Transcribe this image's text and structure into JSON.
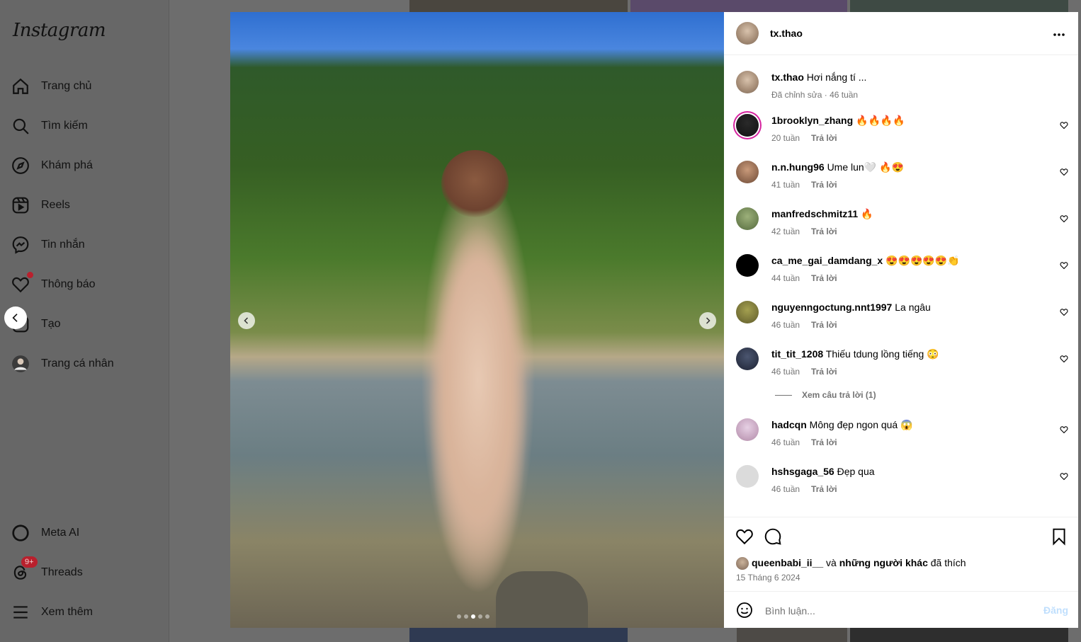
{
  "sidebar": {
    "logo": "Instagram",
    "items": [
      {
        "label": "Trang chủ",
        "icon": "home-icon"
      },
      {
        "label": "Tìm kiếm",
        "icon": "search-icon"
      },
      {
        "label": "Khám phá",
        "icon": "compass-icon"
      },
      {
        "label": "Reels",
        "icon": "reels-icon"
      },
      {
        "label": "Tin nhắn",
        "icon": "messenger-icon"
      },
      {
        "label": "Thông báo",
        "icon": "heart-icon"
      },
      {
        "label": "Tạo",
        "icon": "create-icon"
      },
      {
        "label": "Trang cá nhân",
        "icon": "profile-avatar-icon"
      }
    ],
    "bottom_items": [
      {
        "label": "Meta AI",
        "icon": "meta-ai-icon"
      },
      {
        "label": "Threads",
        "icon": "threads-icon",
        "badge": "9+"
      },
      {
        "label": "Xem thêm",
        "icon": "menu-icon"
      }
    ]
  },
  "post": {
    "author": "tx.thao",
    "caption": "Hơi nắng tí ...",
    "caption_meta": "Đã chỉnh sửa · 46 tuần",
    "carousel_total": 5,
    "carousel_active": 3
  },
  "comments": [
    {
      "user": "1brooklyn_zhang",
      "text": "🔥🔥🔥🔥",
      "time": "20 tuần",
      "reply": "Trả lời"
    },
    {
      "user": "n.n.hung96",
      "text": "Ume lun🤍 🔥😍",
      "time": "41 tuần",
      "reply": "Trả lời"
    },
    {
      "user": "manfredschmitz11",
      "text": "🔥",
      "time": "42 tuần",
      "reply": "Trả lời"
    },
    {
      "user": "ca_me_gai_damdang_x",
      "text": "😍😍😍😍😍👏",
      "time": "44 tuần",
      "reply": "Trả lời"
    },
    {
      "user": "nguyenngoctung.nnt1997",
      "text": "La ngâu",
      "time": "46 tuần",
      "reply": "Trả lời"
    },
    {
      "user": "tit_tit_1208",
      "text": "Thiếu tdung lồng tiếng 😳",
      "time": "46 tuần",
      "reply": "Trả lời",
      "view_replies": "Xem câu trả lời (1)"
    },
    {
      "user": "hadcqn",
      "text": "Mông đẹp ngon quá 😱",
      "time": "46 tuần",
      "reply": "Trả lời"
    },
    {
      "user": "hshsgaga_56",
      "text": "Đẹp qua",
      "time": "46 tuần",
      "reply": "Trả lời"
    }
  ],
  "likes": {
    "user": "queenbabi_ii__",
    "connector": "và",
    "others": "những người khác",
    "suffix": "đã thích"
  },
  "date": "15 Tháng 6 2024",
  "comment_box": {
    "placeholder": "Bình luận...",
    "post_label": "Đăng"
  },
  "colors": {
    "overlay": "#6d6d6d",
    "meta_text": "#737373",
    "post_disabled": "#c0dffd",
    "badge": "#b9202d"
  }
}
